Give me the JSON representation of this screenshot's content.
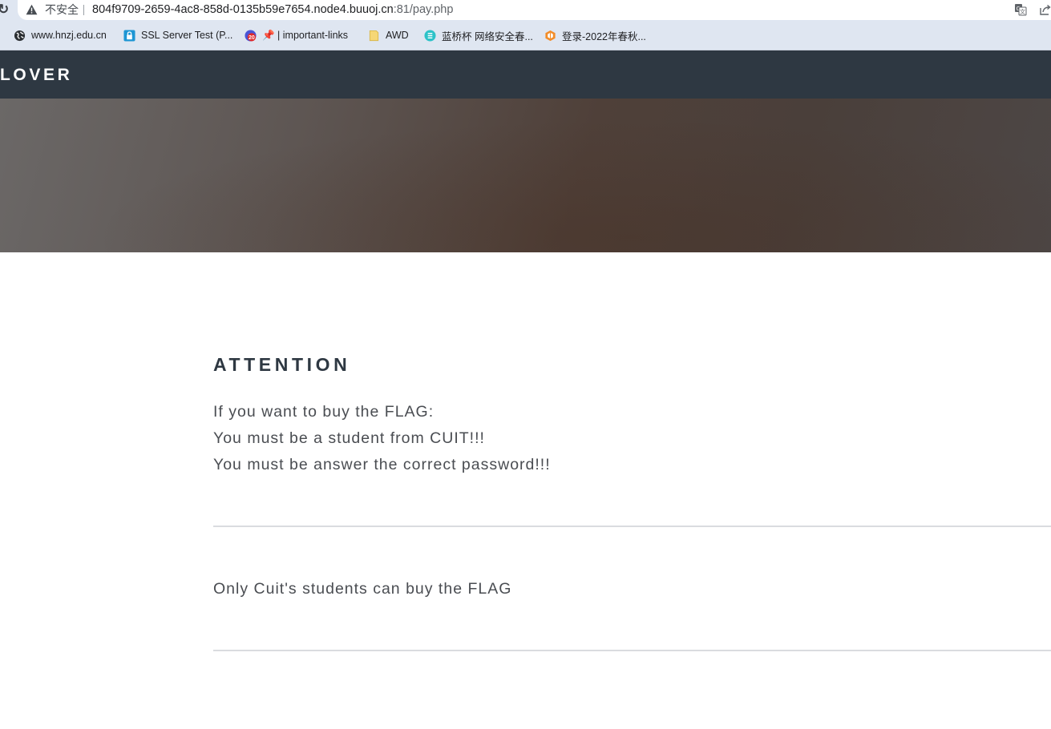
{
  "browser": {
    "security_label": "不安全",
    "url_host": "804f9709-2659-4ac8-858d-0135b59e7654.node4.buuoj.cn",
    "url_tail": ":81/pay.php",
    "bookmarks": [
      {
        "label": "www.hnzj.edu.cn",
        "icon": "globe-icon"
      },
      {
        "label": "SSL Server Test (P...",
        "icon": "ssl-lock-icon"
      },
      {
        "label": "📌 | important-links",
        "icon": "badge-20-icon"
      },
      {
        "label": "AWD",
        "icon": "folder-icon"
      },
      {
        "label": "蓝桥杯 网络安全春...",
        "icon": "lanqiao-icon"
      },
      {
        "label": "登录-2022年春秋...",
        "icon": "cube-icon"
      }
    ]
  },
  "site": {
    "logo": "LOVER"
  },
  "main": {
    "heading": "ATTENTION",
    "intro_lines": [
      "If you want to buy the FLAG:",
      "You must be a student from CUIT!!!",
      "You must be answer the correct password!!!"
    ],
    "notice": "Only Cuit's students can buy the FLAG"
  },
  "colors": {
    "nav_background": "#2e3842",
    "heading": "#2e3842",
    "body_text": "#4a4d52",
    "chrome": "#dfe6f1"
  }
}
